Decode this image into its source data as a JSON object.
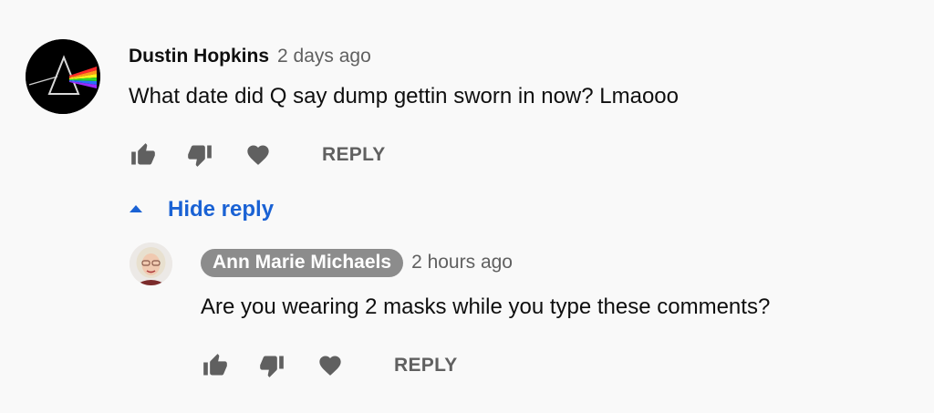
{
  "comment": {
    "author": "Dustin Hopkins",
    "time": "2 days ago",
    "text": "What date did Q say dump gettin sworn in now?  Lmaooo",
    "avatar_icon": "prism-avatar-icon",
    "reply_label": "REPLY"
  },
  "replies_toggle": {
    "label": "Hide reply",
    "icon": "caret-up-icon"
  },
  "reply": {
    "author": "Ann Marie Michaels",
    "time": "2 hours ago",
    "text": "Are you wearing 2 masks while you type these comments?",
    "avatar_icon": "user-photo-avatar",
    "reply_label": "REPLY"
  },
  "colors": {
    "background": "#f9f9f9",
    "link_blue": "#1a62d4",
    "icon_gray": "#606060",
    "badge_gray": "#8c8c8c"
  }
}
